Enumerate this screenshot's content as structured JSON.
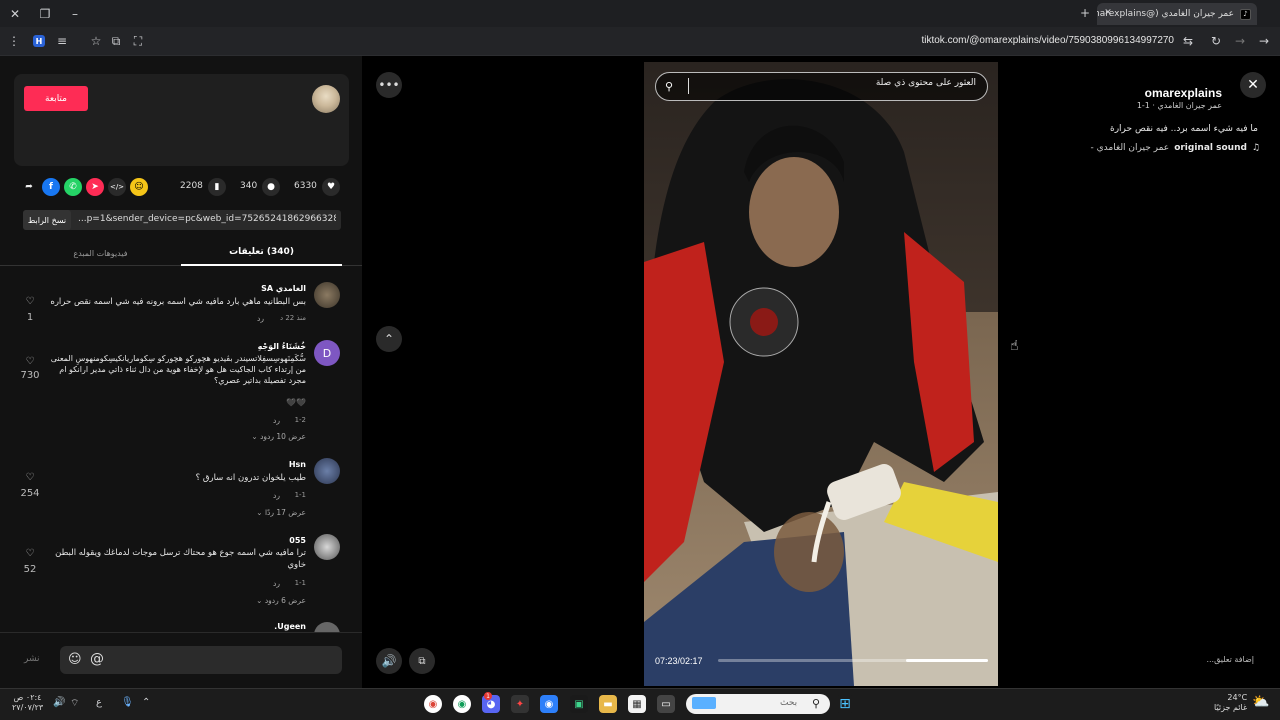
{
  "browser": {
    "tab_title": "عمر جيران الغامدي (@omarexplains",
    "url": "tiktok.com/@omarexplains/video/7590380996134997270",
    "new_tab": "+",
    "close": "✕"
  },
  "profile": {
    "username": "omarexplains",
    "subtitle": "عمر جيران الغامدي · 1-1",
    "follow_label": "متابعة",
    "description": "ما فيه شيء اسمه برد.. فيه نقص حرارة",
    "sound_name": "original sound",
    "sound_author": "- عمر جيران الغامدي"
  },
  "actions": {
    "likes": "6330",
    "comments": "340",
    "saves": "2208"
  },
  "share": {
    "link": "...p=1&sender_device=pc&web_id=7526524186296632833",
    "copy_label": "نسخ الرابط"
  },
  "tabs": {
    "comments": "(340) تعليقات",
    "creator_videos": "فيديوهات المبدع"
  },
  "comments": [
    {
      "name": "الغامدي SA",
      "text": "بس البطانيه ماهي بارد مافيه شي اسمه برونه فيه شي اسمه نقص حراره",
      "meta": "منذ 22 د",
      "reply": "رد",
      "likes": "1"
    },
    {
      "name": "خُشَنَاءُ الوَجْهِ",
      "text": "سُّكَمِنَهوسِسفِلاتسيندر بڤيديو هچورکو هچورکو سِكوماريانكيسِكومنهوسِ المعنى من إرتداء كاب الجاكيت هل هو لإخفاء هوية من دال ثناء ذاتي مدير ارانكو ام مجرد تفصيلة بداتير عصري؟",
      "emoji": "🖤🖤",
      "meta": "1-2",
      "reply": "رد",
      "more": "عرض 10 ردود",
      "likes": "730"
    },
    {
      "name": "Hsn",
      "text": "طيب يلخوان تدرون انه سارق ؟",
      "meta": "1-1",
      "reply": "رد",
      "more": "عرض 17 ردًا",
      "likes": "254"
    },
    {
      "name": "055",
      "text": "ترا مافيه شي اسمه جوع هو محتاك ترسل موجات لدماغك ويقوله البطن خاوي",
      "meta": "1-1",
      "reply": "رد",
      "more": "عرض 6 ردود",
      "likes": "52"
    },
    {
      "name": "Ugeen.",
      "text": "",
      "meta": "",
      "reply": "",
      "likes": ""
    }
  ],
  "comment_input": {
    "placeholder": "إضافة تعليق...",
    "post": "نشر"
  },
  "video": {
    "search_placeholder": "العثور على محتوى ذي صلة",
    "time": "07:23/02:17",
    "progress": 0.7
  },
  "taskbar": {
    "weather_temp": "24°C",
    "weather_desc": "غائم جزئيًا",
    "time": "٠٢:٤ ص",
    "date": "٢٧/٠٧/٢٣",
    "lang": "ع",
    "search_placeholder": "بحث",
    "notif_badge": "1"
  }
}
